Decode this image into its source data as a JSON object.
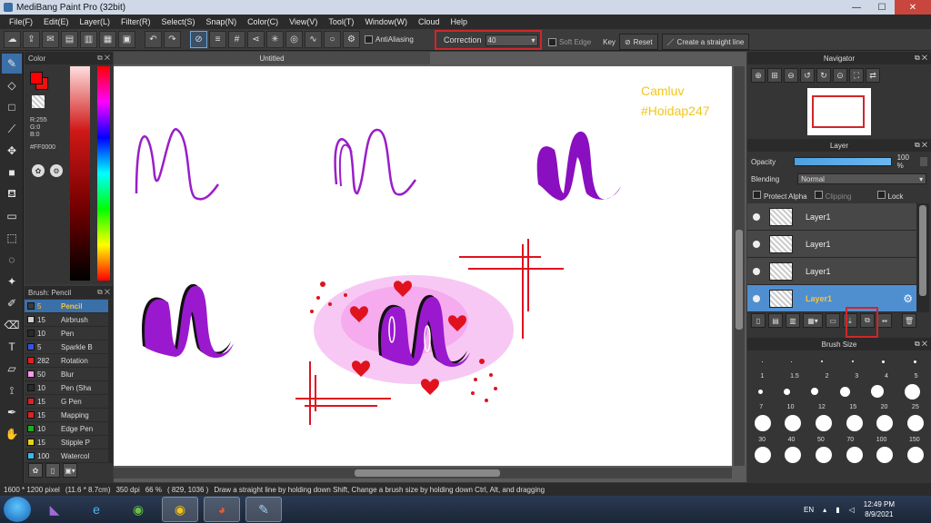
{
  "window": {
    "title": "MediBang Paint Pro (32bit)",
    "controls": {
      "minimize": "—",
      "maximize": "☐",
      "close": "✕"
    }
  },
  "menu": [
    "File(F)",
    "Edit(E)",
    "Layer(L)",
    "Filter(R)",
    "Select(S)",
    "Snap(N)",
    "Color(C)",
    "View(V)",
    "Tool(T)",
    "Window(W)",
    "Cloud",
    "Help"
  ],
  "tool_options": {
    "antialiasing_label": "AntiAliasing",
    "correction_label": "Correction",
    "correction_value": "40",
    "soft_edge_label": "Soft Edge",
    "key_label": "Key",
    "reset_label": "Reset",
    "straight_line_label": "Create a straight line"
  },
  "color_panel": {
    "title": "Color",
    "r": "R:255",
    "g": "G:0",
    "b": "B:0",
    "hex": "#FF0000",
    "primary_color": "#ff0000"
  },
  "brush_panel": {
    "title": "Brush: Pencil",
    "brushes": [
      {
        "size": "5",
        "name": "Pencil",
        "color": "#3b3b3b"
      },
      {
        "size": "15",
        "name": "Airbrush",
        "color": "#cfcfcf"
      },
      {
        "size": "10",
        "name": "Pen",
        "color": "#2a2a2a"
      },
      {
        "size": "5",
        "name": "Sparkle B",
        "color": "#3355dd"
      },
      {
        "size": "282",
        "name": "Rotation",
        "color": "#dd2222"
      },
      {
        "size": "50",
        "name": "Blur",
        "color": "#ff99ee"
      },
      {
        "size": "10",
        "name": "Pen (Sha",
        "color": "#2a2a2a"
      },
      {
        "size": "15",
        "name": "G Pen",
        "color": "#dd2222"
      },
      {
        "size": "15",
        "name": "Mapping",
        "color": "#dd2222"
      },
      {
        "size": "10",
        "name": "Edge Pen",
        "color": "#22aa22"
      },
      {
        "size": "15",
        "name": "Stipple P",
        "color": "#e6d21c"
      },
      {
        "size": "100",
        "name": "Watercol",
        "color": "#38b6f0"
      }
    ]
  },
  "canvas": {
    "tab_title": "Untitled",
    "watermark_line1": "Camluv",
    "watermark_line2": "#Hoidap247"
  },
  "navigator": {
    "title": "Navigator"
  },
  "layer_panel": {
    "title": "Layer",
    "opacity_label": "Opacity",
    "opacity_value": "100 %",
    "opacity_level": 1.0,
    "blending_label": "Blending",
    "blending_value": "Normal",
    "protect_alpha": "Protect Alpha",
    "clipping": "Clipping",
    "lock": "Lock",
    "layers": [
      "Layer1",
      "Layer1",
      "Layer1",
      "Layer1"
    ]
  },
  "brush_size": {
    "title": "Brush Size",
    "sizes_row1": [
      "1",
      "1.5",
      "2",
      "3",
      "4",
      "5"
    ],
    "sizes_row2": [
      "7",
      "10",
      "12",
      "15",
      "20",
      "25"
    ],
    "sizes_row3": [
      "30",
      "40",
      "50",
      "70",
      "100",
      "150"
    ]
  },
  "status": {
    "pixels": "1600 * 1200 pixel",
    "cm": "(11.6 * 8.7cm)",
    "dpi": "350 dpi",
    "zoom": "66 %",
    "coords": "( 829, 1036 )",
    "hint": "Draw a straight line by holding down Shift, Change a brush size by holding down Ctrl, Alt, and dragging"
  },
  "taskbar": {
    "lang": "EN",
    "time": "12:49 PM",
    "date": "8/9/2021"
  }
}
